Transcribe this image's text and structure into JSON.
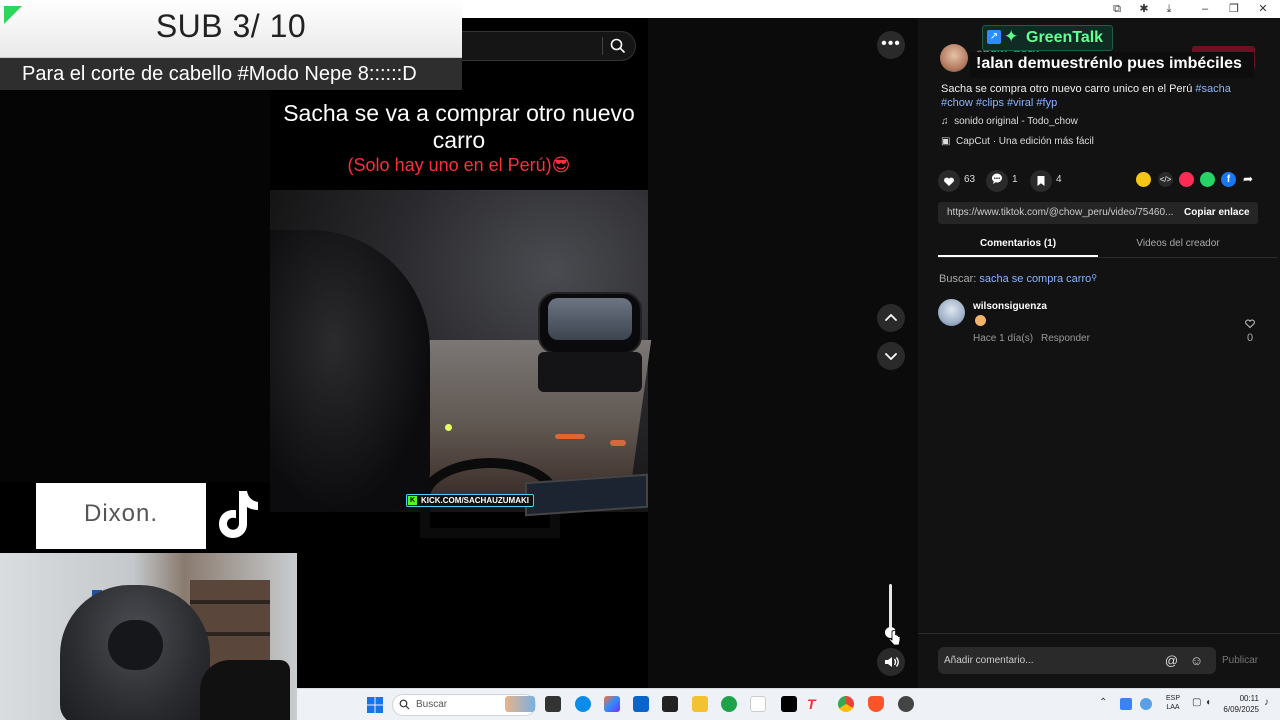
{
  "overlay": {
    "sub_counter": "SUB 3/ 10",
    "reward_text": "Para el corte de cabello #Modo Nepe  8::::::D",
    "dixon_label": "Dixon."
  },
  "video": {
    "caption_line1": "Sacha se va a comprar otro nuevo carro",
    "caption_line2": "(Solo hay uno en el Perú)😎",
    "watermark": "KICK.COM/SACHAUZUMAKI"
  },
  "panel": {
    "author_name": "chow_peru",
    "follow_label": "Seguir",
    "greentalk_label": "GreenTalk",
    "chat_message": "!alan demuestrénlo pues imbéciles",
    "description": "Sacha se compra otro nuevo carro unico en el Perú",
    "hashtags": [
      "#sacha",
      "#chow",
      "#clips",
      "#viral",
      "#fyp"
    ],
    "sound": "sonido original - Todo_chow",
    "capcut": "CapCut · Una edición más fácil",
    "likes": "63",
    "comments_count": "1",
    "saves": "4",
    "link_url": "https://www.tiktok.com/@chow_peru/video/75460...",
    "copy_link_label": "Copiar enlace",
    "tab_comments": "Comentarios (1)",
    "tab_creator_videos": "Videos del creador",
    "search_prefix": "Buscar:",
    "search_term": "sacha se compra carro",
    "comment": {
      "user": "wilsonsiguenza",
      "time": "Hace 1 día(s)",
      "reply_label": "Responder",
      "like_count": "0"
    },
    "comment_placeholder": "Añadir comentario...",
    "publish_label": "Publicar"
  },
  "taskbar": {
    "search_placeholder": "Buscar",
    "lang_line1": "ESP",
    "lang_line2": "LAA",
    "time": "00:11",
    "date": "6/09/2025"
  },
  "colors": {
    "greentalk_green": "#63ff97",
    "caption_red": "#ff2d3d",
    "hashtag_blue": "#8ab4ff",
    "follow_red": "#6d1023"
  }
}
